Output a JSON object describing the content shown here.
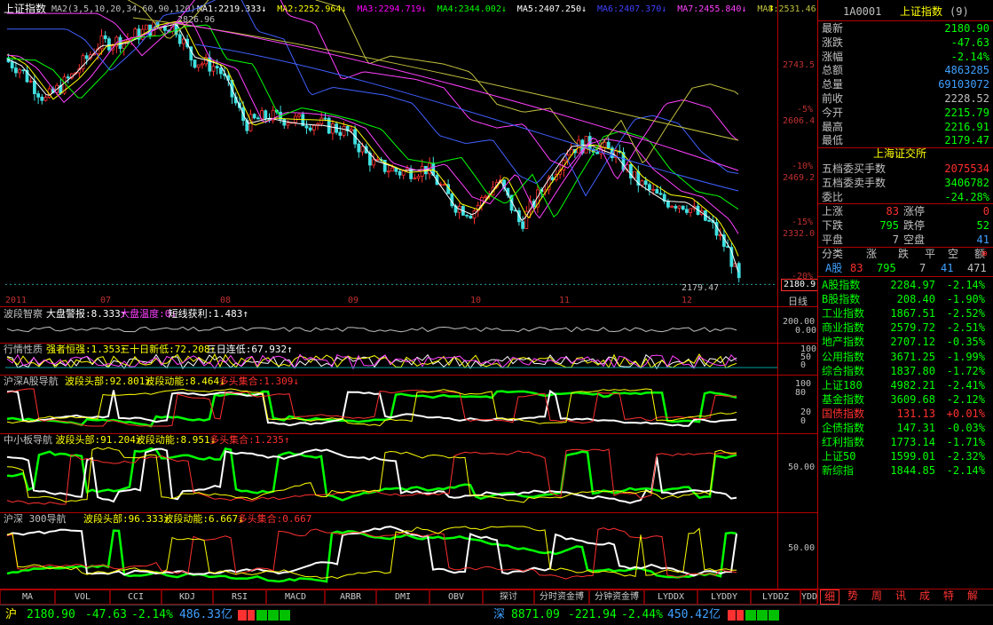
{
  "main_chart": {
    "title": "上证指数",
    "ma_header": "MA2(3,5,10,20,34,60,90,120)",
    "ma_values": [
      {
        "label": "MA1:2219.333↓",
        "color": "#ffffff"
      },
      {
        "label": "MA2:2252.964↓",
        "color": "#ffff00"
      },
      {
        "label": "MA3:2294.719↓",
        "color": "#ff00ff"
      },
      {
        "label": "MA4:2344.002↓",
        "color": "#00ff00"
      },
      {
        "label": "MA5:2407.250↓",
        "color": "#ffffff"
      },
      {
        "label": "MA6:2407.370↓",
        "color": "#4040ff"
      },
      {
        "label": "MA7:2455.840↓",
        "color": "#ff40ff"
      },
      {
        "label": "MA8:2531.46",
        "color": "#c0c040"
      }
    ],
    "arrow_label": "↕",
    "high_label": "2826.96",
    "low_label": "2179.47",
    "current_price_tag": "2180.9",
    "y_axis": [
      {
        "pct": "",
        "price": "2743.5"
      },
      {
        "pct": "-5%",
        "price": "2606.4"
      },
      {
        "pct": "-10%",
        "price": "2469.2"
      },
      {
        "pct": "-15%",
        "price": "2332.0"
      }
    ],
    "y_axis_low": "-20%",
    "x_axis": [
      "2011",
      "07",
      "08",
      "09",
      "10",
      "11",
      "12"
    ],
    "period_label": "日线"
  },
  "chart_data": {
    "type": "candlestick",
    "title": "上证指数",
    "ylim": [
      2179.47,
      2826.96
    ],
    "high": 2826.96,
    "low": 2179.47,
    "close": 2180.9,
    "months": [
      "2011",
      "07",
      "08",
      "09",
      "10",
      "11",
      "12"
    ]
  },
  "indicators": [
    {
      "name": "波段智察",
      "items": [
        {
          "label": "大盘警报:8.333↑",
          "color": "#ffffff"
        },
        {
          "label": "大盘温度:0↓",
          "color": "#ff40ff"
        },
        {
          "label": "短线获利:1.483↑",
          "color": "#ffffff"
        }
      ],
      "axis": [
        "200.00",
        "0.00"
      ]
    },
    {
      "name": "行情性质",
      "items": [
        {
          "label": "强者恒强:1.353↑",
          "color": "#ffff00"
        },
        {
          "label": "三十日新低:72.208↑",
          "color": "#ffff00"
        },
        {
          "label": "三日连低:67.932↑",
          "color": "#ffffff"
        }
      ],
      "axis": [
        "100",
        "50",
        "0"
      ]
    },
    {
      "name": "沪深A股导航",
      "items": [
        {
          "label": "波段头部:92.801↑",
          "color": "#ffff00"
        },
        {
          "label": "波段动能:8.464↓",
          "color": "#ffff00"
        },
        {
          "label": "多头集合:1.309↓",
          "color": "#ff3030"
        }
      ],
      "axis": [
        "100",
        "80",
        "20",
        "0"
      ]
    },
    {
      "name": "中小板导航",
      "items": [
        {
          "label": "波段头部:91.204↑",
          "color": "#ffff00"
        },
        {
          "label": "波段动能:8.951↓",
          "color": "#ffff00"
        },
        {
          "label": "多头集合:1.235↑",
          "color": "#ff3030"
        }
      ],
      "axis": [
        "50.00"
      ]
    },
    {
      "name": "沪深 300导航",
      "items": [
        {
          "label": "波段头部:96.333↑",
          "color": "#ffff00"
        },
        {
          "label": "波段动能:6.667↓",
          "color": "#ffff00"
        },
        {
          "label": "多头集合:0.667",
          "color": "#ff3030"
        }
      ],
      "axis": [
        "50.00"
      ]
    }
  ],
  "bottom_tabs": [
    "MA",
    "VOL",
    "CCI",
    "KDJ",
    "RSI",
    "MACD",
    "ARBR",
    "DMI",
    "OBV",
    "探讨",
    "分时资金博",
    "分钟资金博",
    "LYDDX",
    "LYDDY",
    "LYDDZ",
    "YDD"
  ],
  "right_panel": {
    "code": "1A0001",
    "name": "上证指数",
    "num": "(9)",
    "quote": [
      {
        "label": "最新",
        "value": "2180.90",
        "color": "#00ff00"
      },
      {
        "label": "涨跌",
        "value": "-47.63",
        "color": "#00ff00"
      },
      {
        "label": "涨幅",
        "value": "-2.14%",
        "color": "#00ff00"
      },
      {
        "label": "总额",
        "value": "4863285",
        "color": "#40a0ff"
      },
      {
        "label": "总量",
        "value": "69103072",
        "color": "#40a0ff"
      },
      {
        "label": "前收",
        "value": "2228.52",
        "color": "#c0c0c0"
      },
      {
        "label": "今开",
        "value": "2215.79",
        "color": "#00ff00"
      },
      {
        "label": "最高",
        "value": "2216.91",
        "color": "#00ff00"
      },
      {
        "label": "最低",
        "value": "2179.47",
        "color": "#00ff00"
      }
    ],
    "exchange": "上海证交所",
    "orders": [
      {
        "label": "五档委买手数",
        "value": "2075534",
        "color": "#ff3030"
      },
      {
        "label": "五档委卖手数",
        "value": "3406782",
        "color": "#00ff00"
      },
      {
        "label": "委比",
        "value": "-24.28%",
        "color": "#00ff00"
      }
    ],
    "stats": [
      {
        "l1": "上涨",
        "v1": "83",
        "c1": "#ff3030",
        "l2": "涨停",
        "v2": "0",
        "c2": "#ff3030"
      },
      {
        "l1": "下跌",
        "v1": "795",
        "c1": "#00ff00",
        "l2": "跌停",
        "v2": "52",
        "c2": "#00ff00"
      },
      {
        "l1": "平盘",
        "v1": "7",
        "c1": "#c0c0c0",
        "l2": "空盘",
        "v2": "41",
        "c2": "#40a0ff"
      }
    ],
    "breadth_header": [
      "分类",
      "涨",
      "跌",
      "平",
      "空",
      "额"
    ],
    "breadth_row": {
      "name": "A股",
      "up": "83",
      "down": "795",
      "flat": "7",
      "empty": "41",
      "amount": "471"
    },
    "indices": [
      {
        "name": "A股指数",
        "value": "2284.97",
        "pct": "-2.14%",
        "color": "#00ff00"
      },
      {
        "name": "B股指数",
        "value": "208.40",
        "pct": "-1.90%",
        "color": "#00ff00"
      },
      {
        "name": "工业指数",
        "value": "1867.51",
        "pct": "-2.52%",
        "color": "#00ff00"
      },
      {
        "name": "商业指数",
        "value": "2579.72",
        "pct": "-2.51%",
        "color": "#00ff00"
      },
      {
        "name": "地产指数",
        "value": "2707.12",
        "pct": "-0.35%",
        "color": "#00ff00"
      },
      {
        "name": "公用指数",
        "value": "3671.25",
        "pct": "-1.99%",
        "color": "#00ff00"
      },
      {
        "name": "综合指数",
        "value": "1837.80",
        "pct": "-1.72%",
        "color": "#00ff00"
      },
      {
        "name": "上证180",
        "value": "4982.21",
        "pct": "-2.41%",
        "color": "#00ff00"
      },
      {
        "name": "基金指数",
        "value": "3609.68",
        "pct": "-2.12%",
        "color": "#00ff00"
      },
      {
        "name": "国债指数",
        "value": "131.13",
        "pct": "+0.01%",
        "color": "#ff3030"
      },
      {
        "name": "企债指数",
        "value": "147.31",
        "pct": "-0.03%",
        "color": "#00ff00"
      },
      {
        "name": "红利指数",
        "value": "1773.14",
        "pct": "-1.71%",
        "color": "#00ff00"
      },
      {
        "name": "上证50",
        "value": "1599.01",
        "pct": "-2.32%",
        "color": "#00ff00"
      },
      {
        "name": "新综指",
        "value": "1844.85",
        "pct": "-2.14%",
        "color": "#00ff00"
      }
    ],
    "tabs": [
      "细",
      "势",
      "周",
      "讯",
      "成",
      "特",
      "解"
    ]
  },
  "status_bar": {
    "sh_label": "沪",
    "sh_value": "2180.90",
    "sh_change": "-47.63",
    "sh_pct": "-2.14%",
    "sh_amount": "486.33亿",
    "sz_label": "深",
    "sz_value": "8871.09",
    "sz_change": "-221.94",
    "sz_pct": "-2.44%",
    "sz_amount": "450.42亿"
  }
}
